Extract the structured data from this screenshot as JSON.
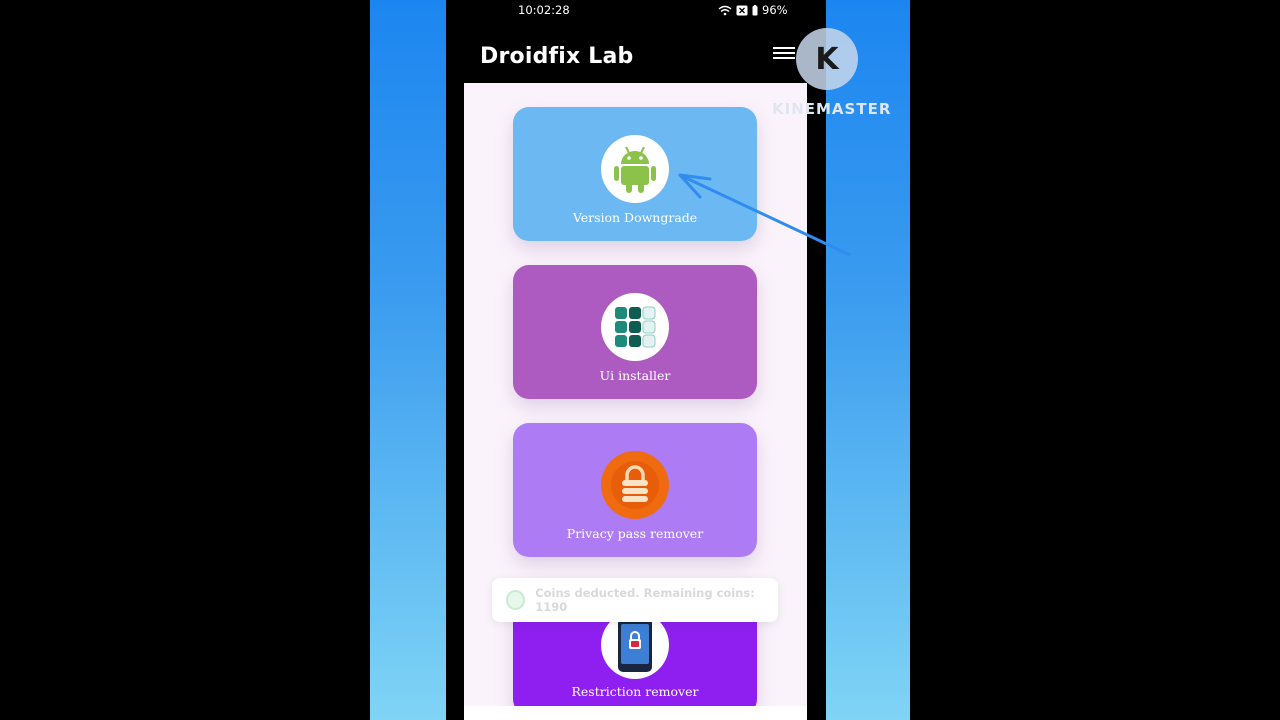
{
  "status_bar": {
    "time": "10:02:28",
    "battery": "96%"
  },
  "app": {
    "title": "Droidfix Lab"
  },
  "cards": [
    {
      "label": "Version Downgrade",
      "icon": "android-icon",
      "color": "#6cb8f2"
    },
    {
      "label": "Ui installer",
      "icon": "grid-icon",
      "color": "#ae5bc1"
    },
    {
      "label": "Privacy pass remover",
      "icon": "lock-icon",
      "color": "#ad7cf4"
    },
    {
      "label": "Restriction remover",
      "icon": "phone-lock-icon",
      "color": "#8e1ff0"
    }
  ],
  "toast": {
    "message": "Coins deducted. Remaining coins: 1190"
  },
  "watermark": {
    "text": "KINEMASTER"
  }
}
